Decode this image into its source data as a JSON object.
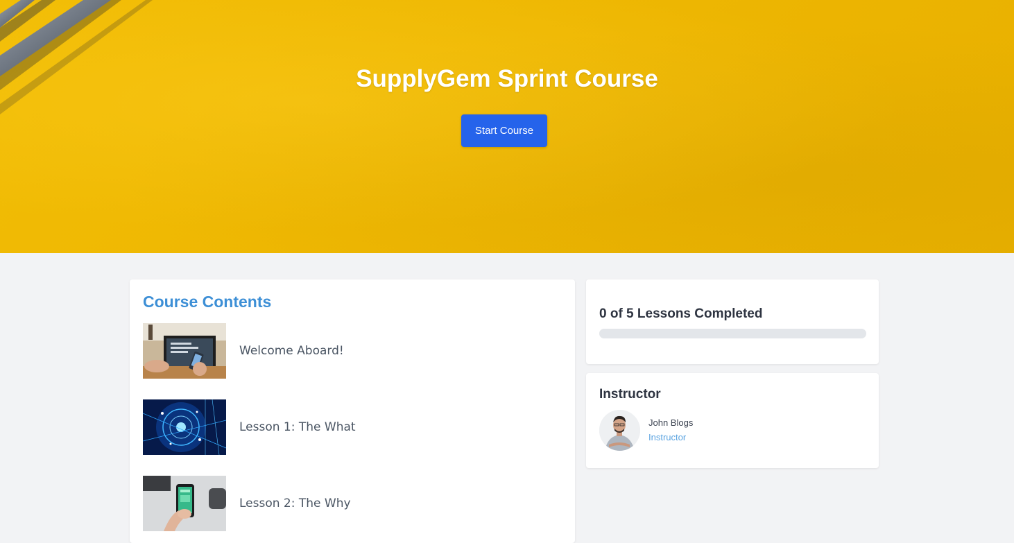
{
  "hero": {
    "title": "SupplyGem Sprint Course",
    "start_button": "Start Course",
    "background_color": "#f0b905",
    "button_color": "#2563eb"
  },
  "course_contents": {
    "heading": "Course Contents",
    "lessons": [
      {
        "title": "Welcome Aboard!",
        "thumbnail": "laptop-and-phone-photo"
      },
      {
        "title": "Lesson 1: The What",
        "thumbnail": "digital-network-photo"
      },
      {
        "title": "Lesson 2: The Why",
        "thumbnail": "hand-holding-phone-photo"
      }
    ]
  },
  "progress": {
    "label": "0 of 5 Lessons Completed",
    "completed": 0,
    "total": 5
  },
  "instructor": {
    "heading": "Instructor",
    "name": "John Blogs",
    "role": "Instructor"
  }
}
